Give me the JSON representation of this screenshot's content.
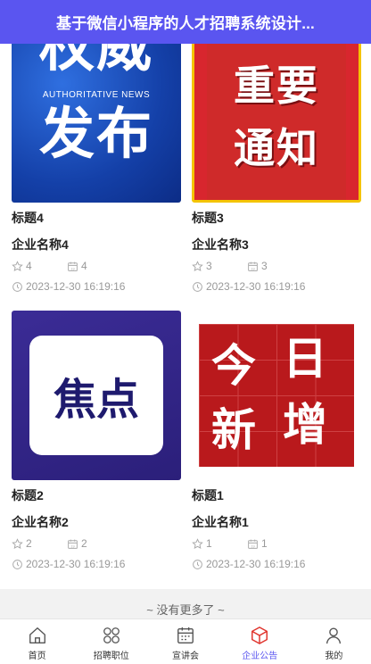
{
  "header": {
    "title": "基于微信小程序的人才招聘系统设计..."
  },
  "thumb_text": {
    "authoritative": {
      "line1": "权威",
      "line2": "发布",
      "sub": "AUTHORITATIVE NEWS"
    },
    "notice": {
      "line1": "重要",
      "line2": "通知"
    },
    "focus": {
      "text": "焦点"
    },
    "today": {
      "c1": "今",
      "c2": "日",
      "c3": "新",
      "c4": "增"
    }
  },
  "cards": [
    {
      "title": "标题4",
      "company": "企业名称4",
      "likes": "4",
      "collects": "4",
      "date": "2023-12-30 16:19:16"
    },
    {
      "title": "标题3",
      "company": "企业名称3",
      "likes": "3",
      "collects": "3",
      "date": "2023-12-30 16:19:16"
    },
    {
      "title": "标题2",
      "company": "企业名称2",
      "likes": "2",
      "collects": "2",
      "date": "2023-12-30 16:19:16"
    },
    {
      "title": "标题1",
      "company": "企业名称1",
      "likes": "1",
      "collects": "1",
      "date": "2023-12-30 16:19:16"
    }
  ],
  "list_end": "~ 没有更多了 ~",
  "tabbar": {
    "items": [
      {
        "label": "首页",
        "icon": "home-icon"
      },
      {
        "label": "招聘职位",
        "icon": "grid-icon"
      },
      {
        "label": "宣讲会",
        "icon": "calendar-icon"
      },
      {
        "label": "企业公告",
        "icon": "box-icon",
        "active": true
      },
      {
        "label": "我的",
        "icon": "user-icon"
      }
    ],
    "active_color": "#e0342d"
  },
  "colors": {
    "header_bg": "#5a55f0",
    "meta_text": "#999999"
  }
}
